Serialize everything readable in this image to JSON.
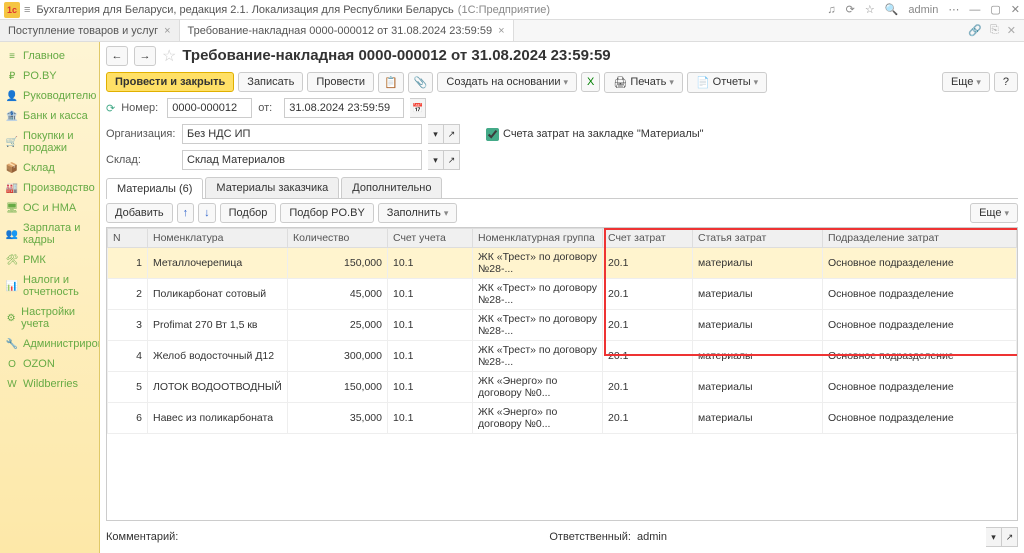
{
  "titlebar": {
    "app": "Бухгалтерия для Беларуси, редакция 2.1. Локализация для Республики Беларусь",
    "sub": "(1С:Предприятие)",
    "user": "admin"
  },
  "tabs": [
    {
      "label": "Поступление товаров и услуг"
    },
    {
      "label": "Требование-накладная 0000-000012 от 31.08.2024 23:59:59"
    }
  ],
  "sidebar": [
    {
      "icon": "≡",
      "label": "Главное"
    },
    {
      "icon": "₽",
      "label": "PO.BY"
    },
    {
      "icon": "👤",
      "label": "Руководителю"
    },
    {
      "icon": "🏦",
      "label": "Банк и касса"
    },
    {
      "icon": "🛒",
      "label": "Покупки и продажи"
    },
    {
      "icon": "📦",
      "label": "Склад"
    },
    {
      "icon": "🏭",
      "label": "Производство"
    },
    {
      "icon": "🖥",
      "label": "ОС и НМА"
    },
    {
      "icon": "👥",
      "label": "Зарплата и кадры"
    },
    {
      "icon": "🛠",
      "label": "РМК"
    },
    {
      "icon": "📊",
      "label": "Налоги и отчетность"
    },
    {
      "icon": "⚙",
      "label": "Настройки учета"
    },
    {
      "icon": "🔧",
      "label": "Администрирование"
    },
    {
      "icon": "O",
      "label": "OZON"
    },
    {
      "icon": "W",
      "label": "Wildberries"
    }
  ],
  "header": {
    "title": "Требование-накладная 0000-000012 от 31.08.2024 23:59:59"
  },
  "toolbar": {
    "post_close": "Провести и закрыть",
    "write": "Записать",
    "post": "Провести",
    "create_based": "Создать на основании",
    "print": "Печать",
    "reports": "Отчеты",
    "more": "Еще",
    "help": "?"
  },
  "form": {
    "number_label": "Номер:",
    "number": "0000-000012",
    "from_label": "от:",
    "date": "31.08.2024 23:59:59",
    "org_label": "Организация:",
    "org": "Без НДС ИП",
    "warehouse_label": "Склад:",
    "warehouse": "Склад Материалов",
    "cost_tab_check": "Счета затрат на закладке \"Материалы\""
  },
  "doctabs": {
    "materials": "Материалы (6)",
    "customer": "Материалы заказчика",
    "extra": "Дополнительно"
  },
  "subtoolbar": {
    "add": "Добавить",
    "pick": "Подбор",
    "pick_poby": "Подбор PO.BY",
    "fill": "Заполнить",
    "more": "Еще"
  },
  "columns": {
    "n": "N",
    "nomen": "Номенклатура",
    "qty": "Количество",
    "acct": "Счет учета",
    "group": "Номенклатурная группа",
    "cost_acct": "Счет затрат",
    "cost_item": "Статья затрат",
    "dept": "Подразделение затрат"
  },
  "rows": [
    {
      "n": "1",
      "nomen": "Металлочерепица",
      "qty": "150,000",
      "acct": "10.1",
      "group": "ЖК «Трест» по договору №28-...",
      "cost_acct": "20.1",
      "cost_item": "материалы",
      "dept": "Основное подразделение"
    },
    {
      "n": "2",
      "nomen": "Поликарбонат сотовый",
      "qty": "45,000",
      "acct": "10.1",
      "group": "ЖК «Трест» по договору №28-...",
      "cost_acct": "20.1",
      "cost_item": "материалы",
      "dept": "Основное подразделение"
    },
    {
      "n": "3",
      "nomen": "Profimat 270 Вт 1,5 кв",
      "qty": "25,000",
      "acct": "10.1",
      "group": "ЖК «Трест» по договору №28-...",
      "cost_acct": "20.1",
      "cost_item": "материалы",
      "dept": "Основное подразделение"
    },
    {
      "n": "4",
      "nomen": "Желоб водосточный Д12",
      "qty": "300,000",
      "acct": "10.1",
      "group": "ЖК «Трест» по договору №28-...",
      "cost_acct": "20.1",
      "cost_item": "материалы",
      "dept": "Основное подразделение"
    },
    {
      "n": "5",
      "nomen": "ЛОТОК ВОДООТВОДНЫЙ",
      "qty": "150,000",
      "acct": "10.1",
      "group": "ЖК «Энерго» по договору №0...",
      "cost_acct": "20.1",
      "cost_item": "материалы",
      "dept": "Основное подразделение"
    },
    {
      "n": "6",
      "nomen": "Навес из поликарбоната",
      "qty": "35,000",
      "acct": "10.1",
      "group": "ЖК «Энерго» по договору №0...",
      "cost_acct": "20.1",
      "cost_item": "материалы",
      "dept": "Основное подразделение"
    }
  ],
  "footer": {
    "comment_label": "Комментарий:",
    "comment": "",
    "resp_label": "Ответственный:",
    "resp": "admin"
  }
}
